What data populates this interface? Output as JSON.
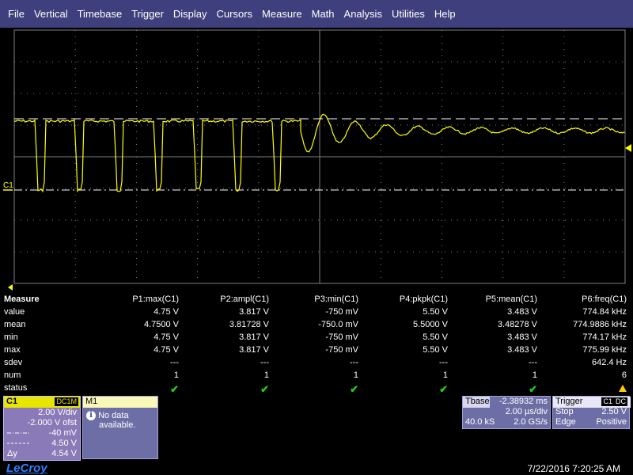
{
  "menu": [
    "File",
    "Vertical",
    "Timebase",
    "Trigger",
    "Display",
    "Cursors",
    "Measure",
    "Math",
    "Analysis",
    "Utilities",
    "Help"
  ],
  "scope": {
    "channel_label": "C1",
    "trace_color": "#ffff00",
    "grid_color": "#808080"
  },
  "measure": {
    "title": "Measure",
    "columns": [
      "P1:max(C1)",
      "P2:ampl(C1)",
      "P3:min(C1)",
      "P4:pkpk(C1)",
      "P5:mean(C1)",
      "P6:freq(C1)"
    ],
    "rows": [
      {
        "label": "value",
        "cells": [
          "4.75 V",
          "3.817 V",
          "-750 mV",
          "5.50 V",
          "3.483 V",
          "774.84 kHz"
        ]
      },
      {
        "label": "mean",
        "cells": [
          "4.7500 V",
          "3.81728 V",
          "-750.0 mV",
          "5.5000 V",
          "3.48278 V",
          "774.9886 kHz"
        ]
      },
      {
        "label": "min",
        "cells": [
          "4.75 V",
          "3.817 V",
          "-750 mV",
          "5.50 V",
          "3.483 V",
          "774.17 kHz"
        ]
      },
      {
        "label": "max",
        "cells": [
          "4.75 V",
          "3.817 V",
          "-750 mV",
          "5.50 V",
          "3.483 V",
          "775.99 kHz"
        ]
      },
      {
        "label": "sdev",
        "cells": [
          "---",
          "---",
          "---",
          "---",
          "---",
          "642.4 Hz"
        ]
      },
      {
        "label": "num",
        "cells": [
          "1",
          "1",
          "1",
          "1",
          "1",
          "6"
        ]
      },
      {
        "label": "status",
        "cells": [
          "ok",
          "ok",
          "ok",
          "ok",
          "ok",
          "warn"
        ]
      }
    ]
  },
  "c1": {
    "title": "C1",
    "coupling": "DC1M",
    "vdiv": "2.00 V/div",
    "offset": "-2.000 V ofst",
    "cursor1": "-40 mV",
    "cursor2": "4.50 V",
    "delta_label": "Δy",
    "delta": "4.54 V"
  },
  "m1": {
    "title": "M1",
    "message_line1": "No data",
    "message_line2": "available."
  },
  "timebase": {
    "title": "Tbase",
    "delay": "-2.38932 ms",
    "tdiv": "2.00 µs/div",
    "samples": "40.0 kS",
    "rate": "2.0 GS/s"
  },
  "trigger": {
    "title": "Trigger",
    "tag1": "C1",
    "tag2": "DC",
    "mode": "Stop",
    "level": "2.50 V",
    "type": "Edge",
    "slope": "Positive"
  },
  "brand": "LeCroy",
  "datetime": "7/22/2016 7:20:25 AM"
}
